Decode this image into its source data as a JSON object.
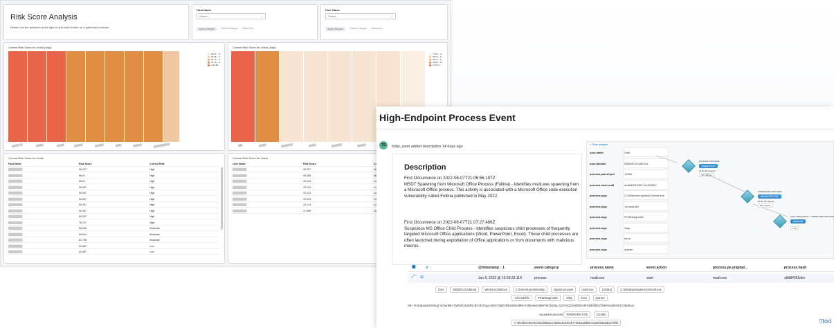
{
  "dashboard": {
    "title": "Risk Score Analysis",
    "subtitle": "Please use the selectors to the right to drill down further on a particular host/user.",
    "host_control": {
      "label": "Host Name",
      "placeholder": "Select...",
      "apply": "Apply changes",
      "cancel": "Cancel changes",
      "clear": "Clear form"
    },
    "user_control": {
      "label": "User Name",
      "placeholder": "Select...",
      "apply": "Apply changes",
      "cancel": "Cancel changes",
      "clear": "Clear form"
    },
    "hosts_chart_title": "Current Risk Score for Hosts (map)",
    "users_chart_title": "Current Risk Score for Users (map)",
    "hosts_legend": [
      "99.67 – 9...",
      "90.06 – 9...",
      "89.76 – 9...",
      "78.26 – 9...",
      "≥ 92.38"
    ],
    "users_legend": [
      "77.59 – 9...",
      "66.19 – 9...",
      "45.01 – 9...",
      "23.02 – 97...",
      "≥ 43.73"
    ],
    "hosts_table_title": "Current Risk Score for Hosts",
    "users_table_title": "Current Risk Score for Users",
    "hosts_table": {
      "headers": [
        "Host Name",
        "Risk Score",
        "Current Risk"
      ],
      "rows": [
        [
          "",
          "98.127",
          "High"
        ],
        [
          "",
          "96.01",
          "High"
        ],
        [
          "",
          "96.01",
          "High"
        ],
        [
          "",
          "90.397",
          "High"
        ],
        [
          "",
          "90.397",
          "High"
        ],
        [
          "",
          "90.397",
          "High"
        ],
        [
          "",
          "90.397",
          "High"
        ],
        [
          "",
          "90.397",
          "High"
        ],
        [
          "",
          "90.397",
          "High"
        ],
        [
          "",
          "78.707",
          "High"
        ],
        [
          "",
          "56.036",
          "Moderate"
        ],
        [
          "",
          "69.044",
          "Moderate"
        ],
        [
          "",
          "51.738",
          "Moderate"
        ],
        [
          "",
          "24.467",
          "Low"
        ],
        [
          "",
          "24.467",
          "Low"
        ]
      ]
    },
    "users_table": {
      "headers": [
        "User Name",
        "Risk Score",
        "Cu"
      ],
      "rows": [
        [
          "",
          "90.397",
          "Hi"
        ],
        [
          "",
          "59.389",
          "Mi"
        ],
        [
          "",
          "23.123",
          "Lo"
        ],
        [
          "",
          "23.123",
          "Lo"
        ],
        [
          "",
          "23.123",
          "Lo"
        ],
        [
          "",
          "23.123",
          "Lo"
        ],
        [
          "",
          "23.123",
          "Lo"
        ],
        [
          "",
          "17.098",
          "Lo"
        ]
      ]
    }
  },
  "event": {
    "title": "High-Endpoint Process Event",
    "avatar": "TS",
    "comment_author": "fodyi_siem added description 14 days ago",
    "description_heading": "Description",
    "para1": "First Occurrence on 2022-06-07T21:06:56.107Z\nMSDT Spawning from Microsoft Office Process (Follina) - Identifies msdt.exe spawning from a Microsoft Office process. This activity is associated with a Microsoft Office code execution vulnerability called Follina published in May 2022.",
    "para2": "First Occurrence on 2022-06-07T21:07:27.486Z\nSuspicious MS Office Child Process - Identifies suspicious child processes of frequently targeted Microsoft Office applications (Word, PowerPoint, Excel). These child processes are often launched during exploitation of Office applications or from documents with malicious macros.",
    "analyzer_link": "× Close analyzer",
    "analyzer_fields": [
      {
        "k": "user.name",
        "v": "User"
      },
      {
        "k": "user.domain",
        "v": "WINDEV2108EVAL"
      },
      {
        "k": "process.parent.pid",
        "v": "11456"
      },
      {
        "k": "process.hash.md5",
        "v": "a9d84261035174e322567"
      },
      {
        "k": "process.args",
        "v": "C:\\Windows\\ system32\\msdt.exe"
      },
      {
        "k": "process.args",
        "v": "-id-msdt.flid"
      },
      {
        "k": "process.args",
        "v": "PCWDiagnostic"
      },
      {
        "k": "process.args",
        "v": "/skip"
      },
      {
        "k": "process.args",
        "v": "force"
      },
      {
        "k": "process.args",
        "v": "/param"
      }
    ],
    "nodes": [
      {
        "kind": "RUNNING PROCESS",
        "name": "explorer.exe",
        "meta": "32 file   56 network",
        "count": "245 registry"
      },
      {
        "kind": "TERMINATED PROCESS",
        "name": "WINWORD.EXE",
        "meta": "82 file   48 network",
        "count": "525 registry"
      },
      {
        "kind": "ANALYZED EVENT - TERMINATED PROCESS",
        "name": "msdt.exe",
        "meta": "",
        "count": "1 file"
      }
    ],
    "timeline_headers": [
      "@timestamp ↓ 1",
      "event.category",
      "process.name",
      "event.action",
      "process.pe.original...",
      "process.hash"
    ],
    "timeline_row": [
      "Jun 5, 2022 @ 15:59:33.119",
      "process",
      "msdt.exe",
      "start",
      "msdt.exe",
      "a9d84261des"
    ],
    "chips_row1": [
      "User",
      "WINDEV2108Eval",
      "WinDev2108Eval",
      "C:\\Users\\User\\Desktop",
      "started process",
      "msdt.exe",
      "(10344)",
      "C:\\Windows\\system32\\msdt.exe"
    ],
    "chips_row2": [
      "-id-msdt.flid",
      "PCWDiagnostic",
      "/skip",
      "force",
      "/param"
    ],
    "chips_row3": "S8+ FromBase64String('+[char]58+'SW52b2tLWRVJkXVk3Gga=ROCHWEVBhaXWed9RuY29tL9exO6B9YW1b25eLJ1Z2-KDZ2e8bDbAJFS8Ib39Ib27tb9AVuvbrM2HCSBx0Lyc",
    "chips_row4": [
      "via parent process",
      "WINWORD.EXE",
      "(11460)"
    ],
    "chips_row5": "# 4816f33c8ee52d4cef08bd17489b12e6dceb772b5115fb507a3a0f54818ba75f0b",
    "watermark": "tod"
  },
  "colors": {
    "high": "#e8654a",
    "mid": "#df8e43",
    "low": "#efc7a3",
    "lighter": "#f8e4d2",
    "accent": "#006bb8"
  }
}
